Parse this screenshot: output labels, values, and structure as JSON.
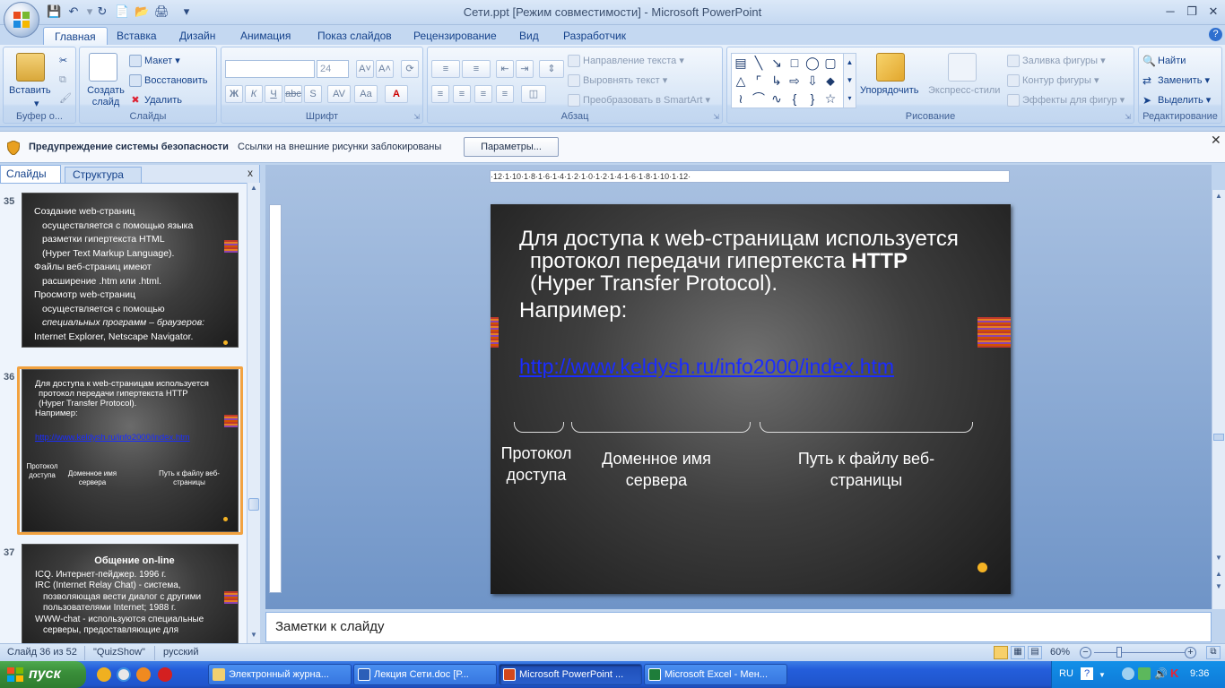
{
  "window": {
    "title": "Сети.ppt [Режим совместимости] - Microsoft PowerPoint",
    "qat_icons": [
      "save-icon",
      "undo-icon",
      "redo-icon",
      "new-icon",
      "open-icon",
      "print-icon"
    ],
    "controls": [
      "minimize",
      "maximize",
      "close"
    ]
  },
  "ribbon": {
    "tabs": [
      "Главная",
      "Вставка",
      "Дизайн",
      "Анимация",
      "Показ слайдов",
      "Рецензирование",
      "Вид",
      "Разработчик"
    ],
    "active_tab": "Главная",
    "clipboard": {
      "paste": "Вставить",
      "label": "Буфер о..."
    },
    "slides_group": {
      "new_slide": "Создать слайд",
      "layout": "Макет",
      "reset": "Восстановить",
      "delete": "Удалить",
      "label": "Слайды"
    },
    "font_group": {
      "font_size": "24",
      "label": "Шрифт",
      "bold": "Ж",
      "italic": "К",
      "underline": "Ч",
      "strike": "abc",
      "spacing": "AV",
      "case": "Aa",
      "color": "A"
    },
    "paragraph_group": {
      "text_direction": "Направление текста",
      "align_text": "Выровнять текст",
      "smartart": "Преобразовать в SmartArt",
      "label": "Абзац"
    },
    "drawing_group": {
      "arrange": "Упорядочить",
      "quick_styles": "Экспресс-стили",
      "fill": "Заливка фигуры",
      "outline": "Контур фигуры",
      "effects": "Эффекты для фигур",
      "label": "Рисование"
    },
    "editing_group": {
      "find": "Найти",
      "replace": "Заменить",
      "select": "Выделить",
      "label": "Редактирование"
    }
  },
  "security": {
    "title": "Предупреждение системы безопасности",
    "message": "Ссылки на внешние рисунки заблокированы",
    "button": "Параметры..."
  },
  "left_pane": {
    "tab_slides": "Слайды",
    "tab_outline": "Структура",
    "slides": [
      {
        "number": "35",
        "lines": [
          "Создание web-страниц",
          "осуществляется с помощью  языка",
          "разметки гипертекста HTML",
          "(Hyper Text Markup Language).",
          "Файлы веб-страниц имеют",
          "расширение .htm или .html.",
          "Просмотр web-страниц",
          "осуществляется с помощью",
          "специальных программ – браузеров:",
          "Internet Explorer, Netscape Navigator."
        ]
      },
      {
        "number": "36",
        "lines": [
          "Для доступа к web-страницам используется",
          "протокол передачи гипертекста HTTP",
          "(Hyper Transfer Protocol).",
          "Например:"
        ],
        "link": "http://www.keldysh.ru/info2000/index.htm",
        "labels": [
          "Протокол доступа",
          "Доменное имя сервера",
          "Путь к файлу веб-страницы"
        ]
      },
      {
        "number": "37",
        "title": "Общение on-line",
        "lines": [
          "ICQ. Интернет-пейджер. 1996 г.",
          "IRC (Internet Relay Chat) - система,",
          "позволяющая вести диалог с другими",
          "пользователями Internet; 1988 г.",
          "WWW-chat - используются специальные",
          "серверы, предоставляющие для"
        ]
      }
    ]
  },
  "ruler": {
    "h_ticks": "·12·1·10·1·8·1·6·1·4·1·2·1·0·1·2·1·4·1·6·1·8·1·10·1·12·"
  },
  "slide": {
    "line1": "Для доступа к web-страницам используется",
    "line2a": "протокол передачи гипертекста ",
    "line2b": "HTTP",
    "line3": "(Hyper Transfer Protocol).",
    "line4": "Например:",
    "link": "http://www.keldysh.ru/info2000/index.htm",
    "label1": "Протокол доступа",
    "label2": "Доменное имя сервера",
    "label3": "Путь к файлу веб-страницы"
  },
  "notes": {
    "placeholder": "Заметки к слайду"
  },
  "status": {
    "slide": "Слайд 36 из 52",
    "theme": "\"QuizShow\"",
    "language": "русский",
    "zoom": "60%"
  },
  "taskbar": {
    "start": "пуск",
    "tasks": [
      "Электронный журна...",
      "Лекция Сети.doc [Р...",
      "Microsoft PowerPoint ...",
      "Microsoft Excel - Мен..."
    ],
    "active_task": 2,
    "lang": "RU",
    "time": "9:36"
  }
}
